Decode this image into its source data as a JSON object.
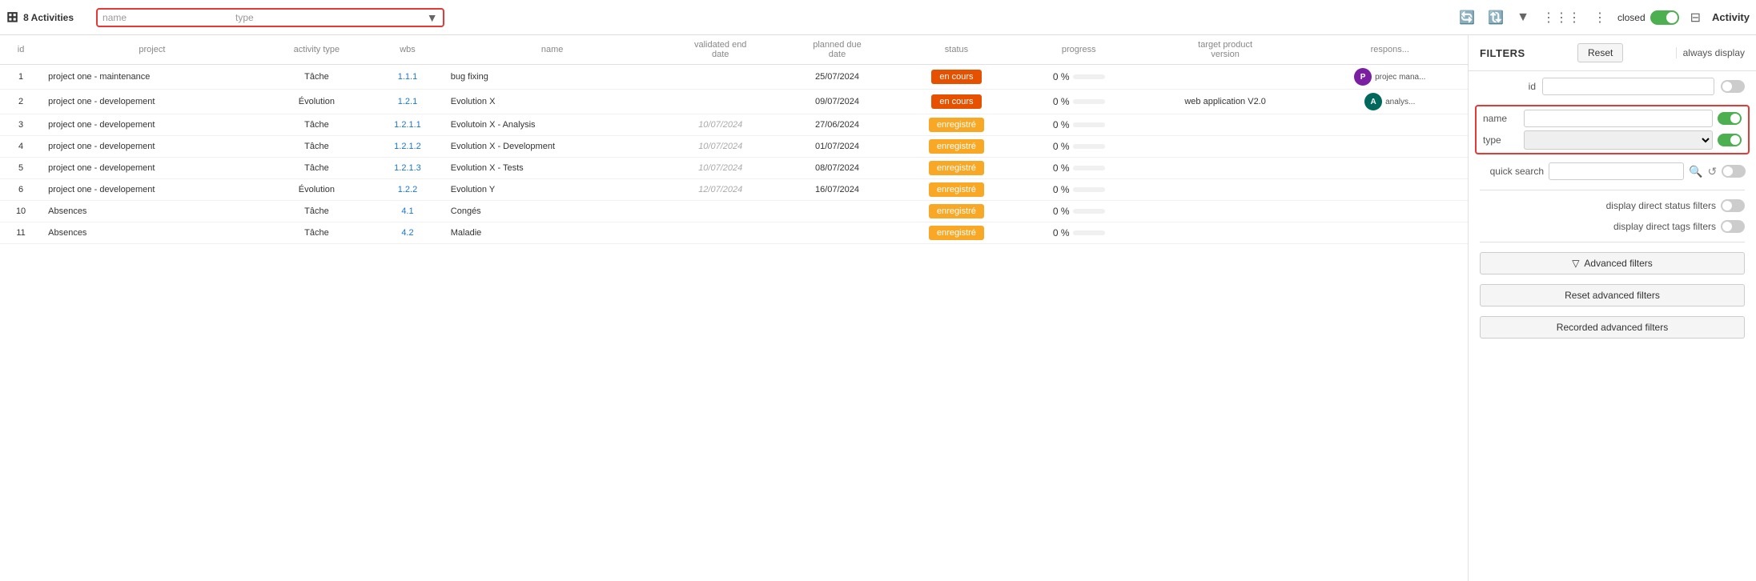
{
  "toolbar": {
    "grid_icon": "⊞",
    "title": "8 Activities",
    "filter_name_label": "name",
    "filter_name_placeholder": "",
    "filter_type_label": "type",
    "filter_type_placeholder": "",
    "icons": {
      "refresh1": "🔄",
      "refresh2": "🔃",
      "filter": "▼",
      "columns": "|||",
      "dots": "⋮",
      "closed_label": "closed",
      "grid2": "⊟"
    },
    "activity_label": "Activity"
  },
  "table": {
    "columns": [
      "id",
      "project",
      "activity type",
      "wbs",
      "name",
      "validated end date",
      "planned due date",
      "status",
      "progress",
      "target product version",
      "respons..."
    ],
    "rows": [
      {
        "id": 1,
        "project": "project one - maintenance",
        "activity_type": "Tâche",
        "wbs": "1.1.1",
        "name": "bug fixing",
        "validated_end": "",
        "planned_due": "25/07/2024",
        "status": "en cours",
        "status_class": "en-cours",
        "progress": "0 %",
        "target_product": "",
        "respons": "P",
        "respons_label": "projec mana...",
        "avatar_color": "purple"
      },
      {
        "id": 2,
        "project": "project one - developement",
        "activity_type": "Évolution",
        "wbs": "1.2.1",
        "name": "Evolution X",
        "validated_end": "",
        "planned_due": "09/07/2024",
        "status": "en cours",
        "status_class": "en-cours",
        "progress": "0 %",
        "target_product": "web application V2.0",
        "respons": "A",
        "respons_label": "analys...",
        "avatar_color": "teal"
      },
      {
        "id": 3,
        "project": "project one - developement",
        "activity_type": "Tâche",
        "wbs": "1.2.1.1",
        "name": "Evolutoin X - Analysis",
        "validated_end": "10/07/2024",
        "planned_due": "27/06/2024",
        "status": "enregistré",
        "status_class": "enregistre",
        "progress": "0 %",
        "target_product": "",
        "respons": "",
        "respons_label": "",
        "avatar_color": ""
      },
      {
        "id": 4,
        "project": "project one - developement",
        "activity_type": "Tâche",
        "wbs": "1.2.1.2",
        "name": "Evolution X - Development",
        "validated_end": "10/07/2024",
        "planned_due": "01/07/2024",
        "status": "enregistré",
        "status_class": "enregistre",
        "progress": "0 %",
        "target_product": "",
        "respons": "",
        "respons_label": "",
        "avatar_color": ""
      },
      {
        "id": 5,
        "project": "project one - developement",
        "activity_type": "Tâche",
        "wbs": "1.2.1.3",
        "name": "Evolution X - Tests",
        "validated_end": "10/07/2024",
        "planned_due": "08/07/2024",
        "status": "enregistré",
        "status_class": "enregistre",
        "progress": "0 %",
        "target_product": "",
        "respons": "",
        "respons_label": "",
        "avatar_color": ""
      },
      {
        "id": 6,
        "project": "project one - developement",
        "activity_type": "Évolution",
        "wbs": "1.2.2",
        "name": "Evolution Y",
        "validated_end": "12/07/2024",
        "planned_due": "16/07/2024",
        "status": "enregistré",
        "status_class": "enregistre",
        "progress": "0 %",
        "target_product": "",
        "respons": "",
        "respons_label": "",
        "avatar_color": ""
      },
      {
        "id": 10,
        "project": "Absences",
        "activity_type": "Tâche",
        "wbs": "4.1",
        "name": "Congés",
        "validated_end": "",
        "planned_due": "",
        "status": "enregistré",
        "status_class": "enregistre",
        "progress": "0 %",
        "target_product": "",
        "respons": "",
        "respons_label": "",
        "avatar_color": ""
      },
      {
        "id": 11,
        "project": "Absences",
        "activity_type": "Tâche",
        "wbs": "4.2",
        "name": "Maladie",
        "validated_end": "",
        "planned_due": "",
        "status": "enregistré",
        "status_class": "enregistre",
        "progress": "0 %",
        "target_product": "",
        "respons": "",
        "respons_label": "",
        "avatar_color": ""
      }
    ]
  },
  "filters_panel": {
    "title": "FILTERS",
    "reset_button": "Reset",
    "always_display_label": "always display",
    "id_label": "id",
    "name_label": "name",
    "type_label": "type",
    "quick_search_label": "quick search",
    "display_status_label": "display direct status filters",
    "display_tags_label": "display direct tags filters",
    "advanced_filters_btn": "Advanced filters",
    "reset_advanced_btn": "Reset advanced filters",
    "recorded_advanced_btn": "Recorded advanced filters",
    "filter_icon": "▽"
  }
}
